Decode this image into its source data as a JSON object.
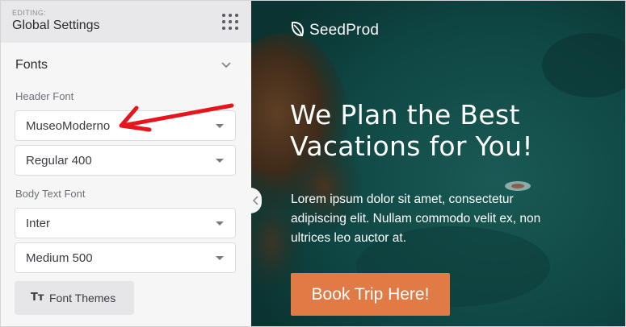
{
  "sidebar": {
    "editing_label": "EDITING:",
    "title": "Global Settings",
    "menu_icon": "grid-dots-icon",
    "section_title": "Fonts",
    "header_font_label": "Header Font",
    "header_font_family": "MuseoModerno",
    "header_font_weight": "Regular 400",
    "body_font_label": "Body Text Font",
    "body_font_family": "Inter",
    "body_font_weight": "Medium 500",
    "font_themes_icon": "Tт",
    "font_themes_label": "Font Themes"
  },
  "preview": {
    "logo_text": "SeedProd",
    "headline": "We Plan the Best Vacations for You!",
    "body": "Lorem ipsum dolor sit amet, consectetur adipiscing elit. Nullam commodo velit ex, non ultrices leo auctor at.",
    "cta_label": "Book Trip Here!"
  },
  "colors": {
    "annotation_arrow": "#e8141b",
    "cta": "#e27a45",
    "preview_background": "#0d3f3d"
  }
}
